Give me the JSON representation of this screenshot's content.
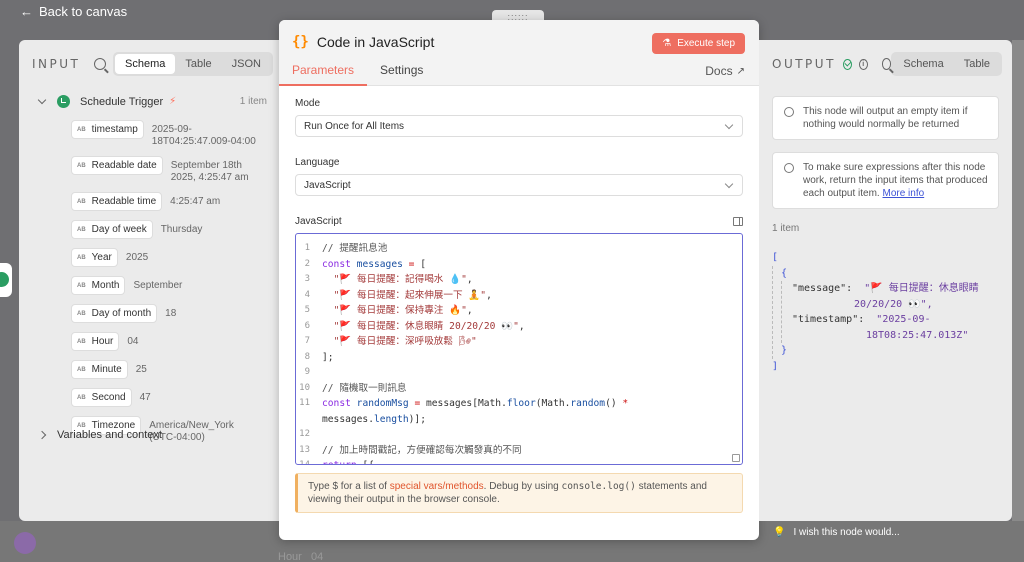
{
  "nav": {
    "back_label": "Back to canvas"
  },
  "drag_handle": "::::::",
  "input": {
    "title": "INPUT",
    "views": [
      "Schema",
      "Table",
      "JSON"
    ],
    "active_view": "Schema",
    "trigger_name": "Schedule Trigger",
    "item_count": "1 item",
    "type_badge": "AB",
    "fields": [
      {
        "name": "timestamp",
        "value": "2025-09-\n18T04:25:47.009-04:00"
      },
      {
        "name": "Readable date",
        "value": "September 18th\n2025, 4:25:47 am"
      },
      {
        "name": "Readable time",
        "value": "4:25:47 am"
      },
      {
        "name": "Day of week",
        "value": "Thursday"
      },
      {
        "name": "Year",
        "value": "2025"
      },
      {
        "name": "Month",
        "value": "September"
      },
      {
        "name": "Day of month",
        "value": "18"
      },
      {
        "name": "Hour",
        "value": "04"
      },
      {
        "name": "Minute",
        "value": "25"
      },
      {
        "name": "Second",
        "value": "47"
      },
      {
        "name": "Timezone",
        "value": "America/New_York\n(UTC-04:00)"
      }
    ],
    "vars_label": "Variables and context"
  },
  "modal": {
    "title": "Code in JavaScript",
    "execute_label": "Execute step",
    "tabs": [
      "Parameters",
      "Settings"
    ],
    "active_tab": "Parameters",
    "docs_label": "Docs",
    "mode_label": "Mode",
    "mode_value": "Run Once for All Items",
    "language_label": "Language",
    "language_value": "JavaScript",
    "code_label": "JavaScript",
    "hint_prefix": "Type $ for a list of ",
    "hint_link": "special vars/methods",
    "hint_middle": ". Debug by using ",
    "hint_code": "console.log()",
    "hint_suffix": " statements and viewing their output in the browser console."
  },
  "output": {
    "title": "OUTPUT",
    "views": [
      "Schema",
      "Table"
    ],
    "notice1": "This node will output an empty item if nothing would normally be returned",
    "notice2": "To make sure expressions after this node work, return the input items that produced each output item.",
    "notice2_link": "More info",
    "item_count": "1 item",
    "json_key_message": "\"message\":",
    "json_val_message_1": "\"🚩 每日提醒：休息眼睛",
    "json_val_message_2": "20/20/20 👀\",",
    "json_key_timestamp": "\"timestamp\":",
    "json_val_timestamp_1": "\"2025-09-",
    "json_val_timestamp_2": "18T08:25:47.013Z\""
  },
  "footer": {
    "wish_label": "I wish this node would..."
  },
  "bg_ghost": {
    "label": "Hour",
    "value": "04"
  },
  "colors": {
    "accent": "#ee6e60",
    "success": "#2a9d62",
    "link": "#3e53d6"
  }
}
